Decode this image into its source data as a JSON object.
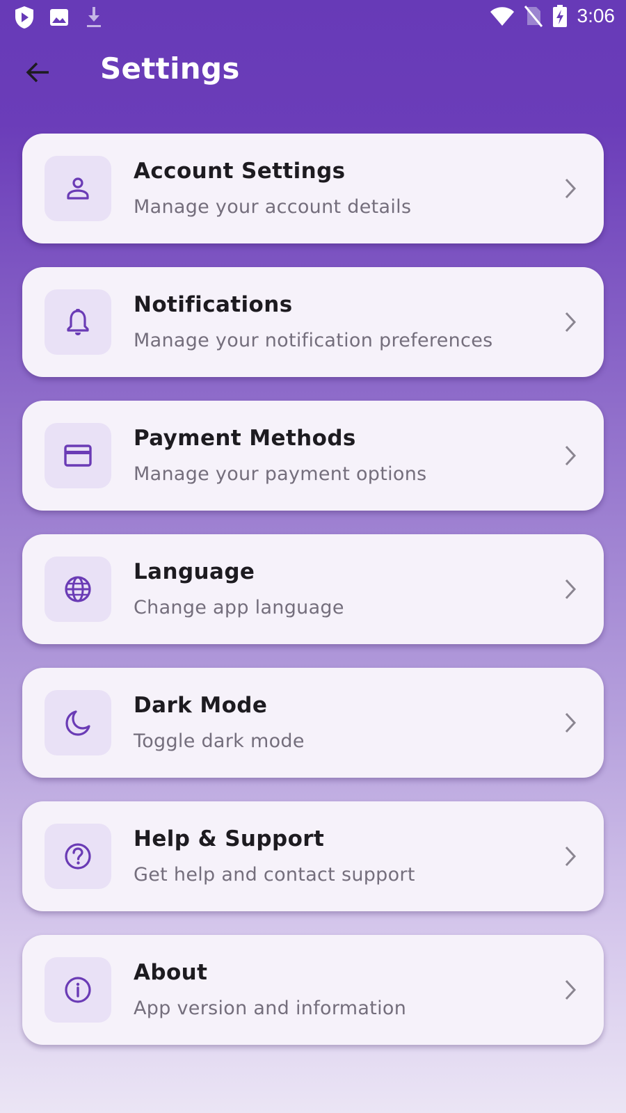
{
  "status_bar": {
    "time": "3:06",
    "left_icons": [
      "play-protect-icon",
      "image-icon",
      "download-icon"
    ],
    "right_icons": [
      "wifi-icon",
      "no-sim-icon",
      "battery-charging-icon"
    ]
  },
  "header": {
    "title": "Settings",
    "back_icon": "arrow-back-icon"
  },
  "colors": {
    "primary": "#673ab7",
    "accent_icon": "#6a3bb5",
    "card_bg": "#f6f2fa",
    "icon_box_bg": "#e9e1f6",
    "title_text": "#1d1b20",
    "subtitle_text": "#746e7c",
    "chevron": "#8a8590"
  },
  "settings": {
    "items": [
      {
        "title": "Account Settings",
        "subtitle": "Manage your account details",
        "icon": "person-icon"
      },
      {
        "title": "Notifications",
        "subtitle": "Manage your notification preferences",
        "icon": "bell-icon"
      },
      {
        "title": "Payment Methods",
        "subtitle": "Manage your payment options",
        "icon": "credit-card-icon"
      },
      {
        "title": "Language",
        "subtitle": "Change app language",
        "icon": "globe-icon"
      },
      {
        "title": "Dark Mode",
        "subtitle": "Toggle dark mode",
        "icon": "moon-icon"
      },
      {
        "title": "Help & Support",
        "subtitle": "Get help and contact support",
        "icon": "help-circle-icon"
      },
      {
        "title": "About",
        "subtitle": "App version and information",
        "icon": "info-icon"
      }
    ]
  }
}
